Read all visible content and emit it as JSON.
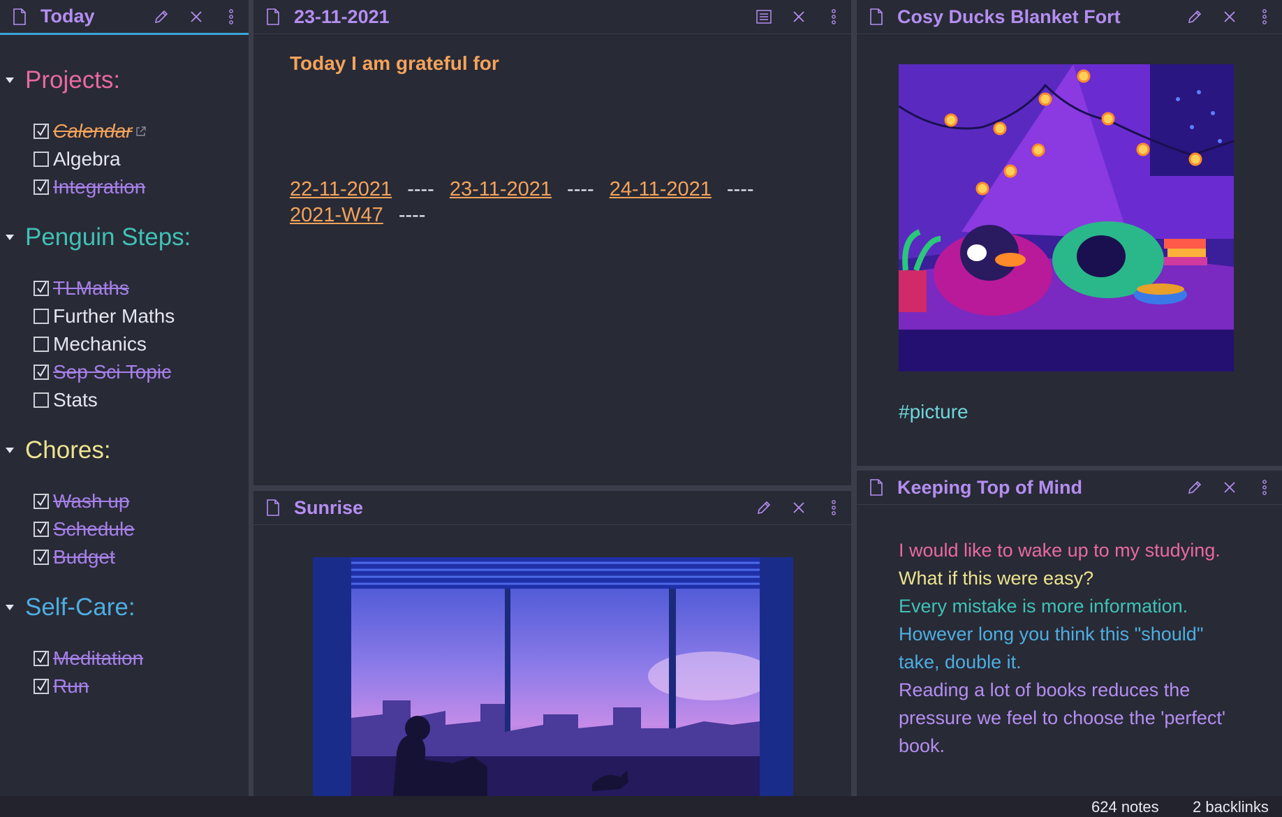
{
  "left_pane": {
    "title": "Today",
    "sections": [
      {
        "heading": "Projects:",
        "color": "#e96aa0",
        "tasks": [
          {
            "label": "Calendar",
            "checked": true,
            "style": "orange-link"
          },
          {
            "label": "Algebra",
            "checked": false
          },
          {
            "label": "Integration",
            "checked": true
          }
        ]
      },
      {
        "heading": "Penguin Steps:",
        "color": "#40c2b6",
        "tasks": [
          {
            "label": "TLMaths",
            "checked": true
          },
          {
            "label": "Further Maths",
            "checked": false
          },
          {
            "label": "Mechanics",
            "checked": false
          },
          {
            "label": "Sep Sci Topic",
            "checked": true
          },
          {
            "label": "Stats",
            "checked": false
          }
        ]
      },
      {
        "heading": "Chores:",
        "color": "#ece48f",
        "tasks": [
          {
            "label": "Wash up",
            "checked": true
          },
          {
            "label": "Schedule",
            "checked": true
          },
          {
            "label": "Budget",
            "checked": true
          }
        ]
      },
      {
        "heading": "Self-Care:",
        "color": "#4eaee0",
        "tasks": [
          {
            "label": "Meditation",
            "checked": true
          },
          {
            "label": "Run",
            "checked": true
          }
        ]
      }
    ]
  },
  "daily_pane": {
    "title": "23-11-2021",
    "grateful": "Today I am grateful for",
    "links": [
      "22-11-2021",
      "23-11-2021",
      "24-11-2021",
      "2021-W47"
    ],
    "separator": "----"
  },
  "sunrise_pane": {
    "title": "Sunrise"
  },
  "cosy_pane": {
    "title": "Cosy Ducks Blanket Fort",
    "tag": "#picture"
  },
  "mind_pane": {
    "title": "Keeping Top of Mind",
    "lines": [
      {
        "text": "I would like to wake up to my studying.",
        "color": "#e96aa0"
      },
      {
        "text": "What if this were easy?",
        "color": "#ece48f"
      },
      {
        "text": "Every mistake is more information.",
        "color": "#40c2b6"
      },
      {
        "text": "However long you think this \"should\" take, double it.",
        "color": "#4eaee0"
      },
      {
        "text": "Reading a lot of books reduces the pressure we feel to choose the 'perfect' book.",
        "color": "#b48ef0"
      }
    ]
  },
  "status_bar": {
    "notes": "624 notes",
    "backlinks": "2 backlinks"
  },
  "colors": {
    "title_purple": "#b48ef0",
    "done_purple": "#a680e8",
    "accent_orange": "#f4a35a",
    "tag_teal": "#6ed6d8",
    "active_underline": "#3aa6d8"
  }
}
